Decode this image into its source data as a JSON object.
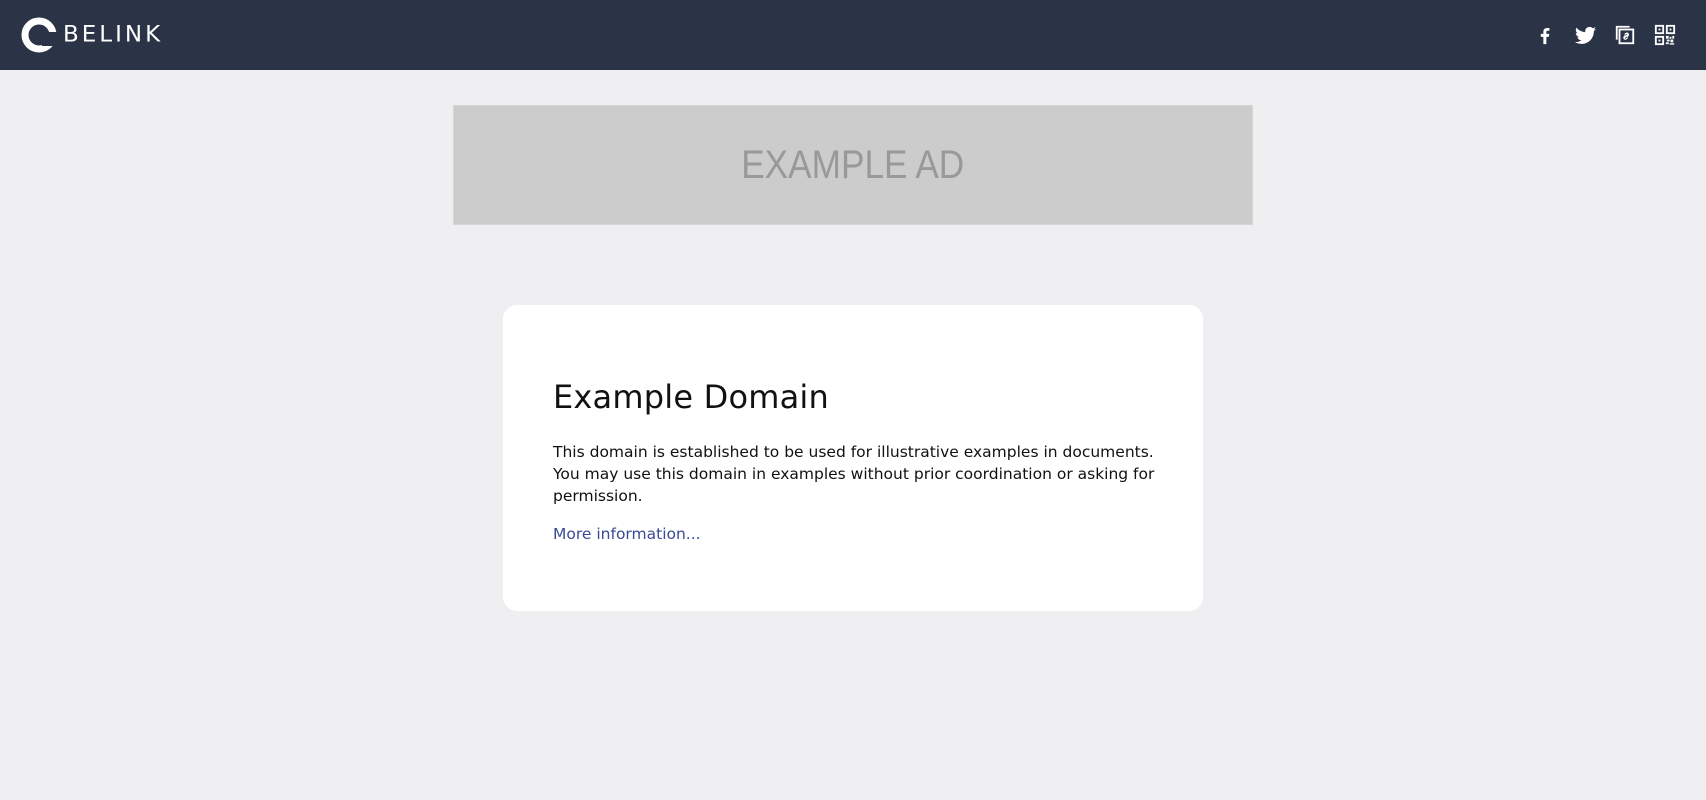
{
  "header": {
    "brand": "BELINK",
    "colors": {
      "background": "#2b3347",
      "icon": "#ffffff"
    },
    "social_icons": [
      {
        "name": "facebook-icon"
      },
      {
        "name": "twitter-icon"
      },
      {
        "name": "copy-link-icon"
      },
      {
        "name": "qr-code-icon"
      }
    ]
  },
  "ad": {
    "text": "EXAMPLE AD"
  },
  "card": {
    "title": "Example Domain",
    "body": "This domain is established to be used for illustrative examples in documents. You may use this domain in examples without prior coordination or asking for permission.",
    "link_text": "More information...",
    "colors": {
      "link": "#3a4a96"
    }
  },
  "page": {
    "background": "#efeff1"
  }
}
